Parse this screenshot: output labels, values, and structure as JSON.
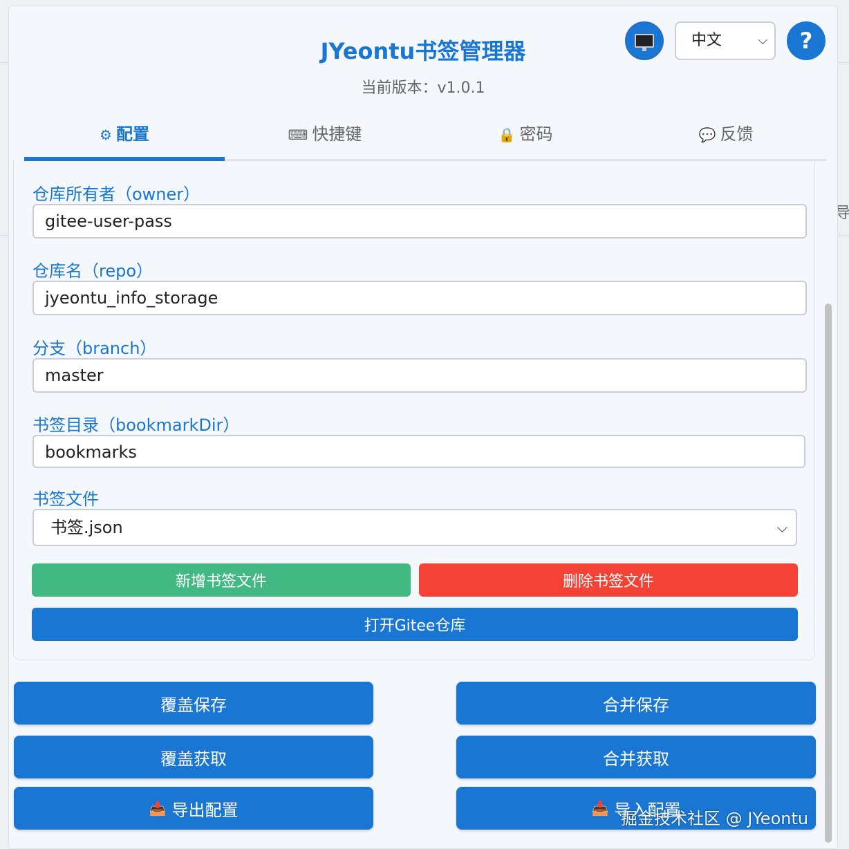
{
  "header": {
    "title": "JYeontu书签管理器",
    "version_label": "当前版本：",
    "version_value": "v1.0.1",
    "language": "中文",
    "help_label": "?"
  },
  "tabs": [
    {
      "icon": "⚙",
      "label": "配置"
    },
    {
      "icon": "⌨",
      "label": "快捷键"
    },
    {
      "icon": "🔒",
      "label": "密码"
    },
    {
      "icon": "💬",
      "label": "反馈"
    }
  ],
  "form": {
    "owner_label": "仓库所有者（owner）",
    "owner_value": "gitee-user-pass",
    "repo_label": "仓库名（repo）",
    "repo_value": "jyeontu_info_storage",
    "branch_label": "分支（branch）",
    "branch_value": "master",
    "dir_label": "书签目录（bookmarkDir）",
    "dir_value": "bookmarks",
    "file_label": "书签文件",
    "file_value": "书签.json"
  },
  "actions": {
    "add_file": "新增书签文件",
    "delete_file": "删除书签文件",
    "open_repo": "打开Gitee仓库",
    "overwrite_save": "覆盖保存",
    "merge_save": "合并保存",
    "overwrite_fetch": "覆盖获取",
    "merge_fetch": "合并获取",
    "export_config": "导出配置",
    "import_config": "导入配置"
  },
  "watermark": "掘金技术社区 @ JYeontu",
  "colors": {
    "primary": "#1976d2",
    "success": "#42b883",
    "danger": "#f44336"
  }
}
